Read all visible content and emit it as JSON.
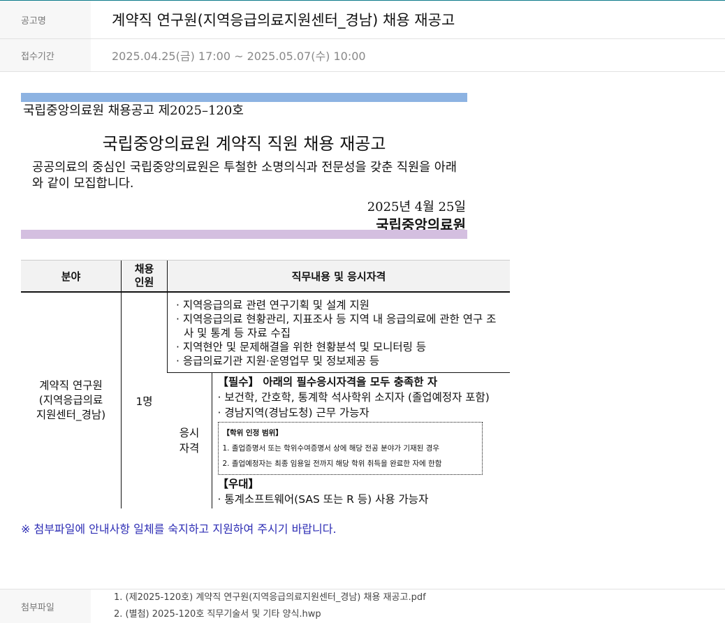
{
  "header": {
    "title_label": "공고명",
    "title": "계약직 연구원(지역응급의료지원센터_경남) 채용 재공고",
    "period_label": "접수기간",
    "period": "2025.04.25(금) 17:00 ~ 2025.05.07(수) 10:00"
  },
  "announcement": {
    "number": "국립중앙의료원 채용공고 제2025–120호",
    "title": "국립중앙의료원 계약직 직원 채용 재공고",
    "intro": "공공의료의 중심인 국립중앙의료원은 투철한 소명의식과 전문성을 갖춘 직원을 아래와 같이 모집합니다.",
    "date": "2025년 4월 25일",
    "org": "국립중앙의료원",
    "bar_top_color": "#8db3e2",
    "bar_bottom_color": "#d4bfe0"
  },
  "table": {
    "headers": [
      "분야",
      "채용\n인원",
      "직무내용 및 응시자격"
    ],
    "field": "계약직 연구원\n(지역응급의료\n지원센터_경남)",
    "count": "1명",
    "duties": [
      "· 지역응급의료 관련 연구기획 및 설계 지원",
      "· 지역응급의료 현황관리, 지표조사 등 지역 내 응급의료에 관한 연구 조사 및 통계 등 자료 수집",
      "· 지역현안 및 문제해결을 위한 현황분석 및 모니터링 등",
      "· 응급의료기관 지원·운영업무 및 정보제공 등"
    ],
    "qual_label": "응시\n자격",
    "required_head": "【필수】 아래의 필수응시자격을 모두 충족한 자",
    "required_items": [
      "· 보건학, 간호학, 통계학 석사학위 소지자 (졸업예정자 포함)",
      "· 경남지역(경남도청) 근무 가능자"
    ],
    "degree_box": {
      "head": "【학위 인정 범위】",
      "items": [
        "1. 졸업증명서 또는 학위수여증명서 상에 해당 전공 분야가 기재된 경우",
        "2. 졸업예정자는 최종 임용일 전까지 해당 학위 취득을 완료한 자에 한함"
      ]
    },
    "preferred_head": "【우대】",
    "preferred_items": [
      "· 통계소프트웨어(SAS 또는 R 등) 사용 가능자"
    ]
  },
  "notice": "※ 첨부파일에 안내사항 일체를 숙지하고 지원하여 주시기 바랍니다.",
  "attachments": {
    "label": "첨부파일",
    "files": [
      "1. (제2025-120호) 계약직 연구원(지역응급의료지원센터_경남) 채용 재공고.pdf",
      "2. (별첨) 2025-120호 직무기술서 및 기타 양식.hwp"
    ]
  }
}
